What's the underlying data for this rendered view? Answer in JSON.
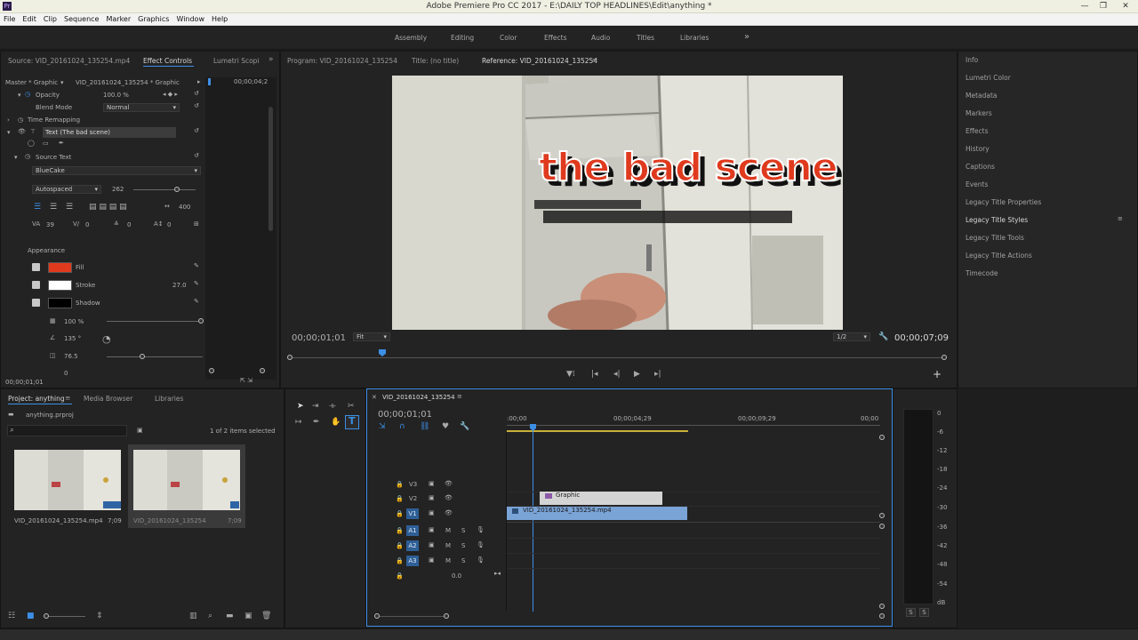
{
  "window": {
    "title": "Adobe Premiere Pro CC 2017 - E:\\DAILY TOP HEADLINES\\Edit\\anything *",
    "menu": [
      "File",
      "Edit",
      "Clip",
      "Sequence",
      "Marker",
      "Graphics",
      "Window",
      "Help"
    ]
  },
  "workspaces": [
    "Assembly",
    "Editing",
    "Color",
    "Effects",
    "Audio",
    "Titles",
    "Libraries"
  ],
  "effect_panel": {
    "tabs": [
      "Source: VID_20161024_135254.mp4",
      "Effect Controls",
      "Lumetri Scopi"
    ],
    "master_label": "Master * Graphic",
    "clip_label": "VID_20161024_135254 * Graphic",
    "timecode_right": "00;00;04;2",
    "opacity_label": "Opacity",
    "opacity_value": "100.0 %",
    "blend_label": "Blend Mode",
    "blend_value": "Normal",
    "time_remapping": "Time Remapping",
    "text_layer": "Text (The bad scene)",
    "source_text": "Source Text",
    "font": "BlueCake",
    "spacing_mode": "Autospaced",
    "size_value": "262",
    "tracking_value": "400",
    "kern_value": "39",
    "tsume_value": "0",
    "leading_value": "0",
    "baseline_value": "0",
    "appearance": "Appearance",
    "fill_label": "Fill",
    "stroke_label": "Stroke",
    "stroke_value": "27.0",
    "shadow_label": "Shadow",
    "shadow_opacity": "100 %",
    "shadow_angle": "135 °",
    "shadow_distance": "76.5",
    "shadow_size_value": "0",
    "bottom_timecode": "00;00;01;01",
    "fill_color": "#e03a1e",
    "stroke_color": "#ffffff",
    "shadow_color": "#000000"
  },
  "program_monitor": {
    "tabs": [
      "Program: VID_20161024_135254",
      "Title: (no title)",
      "Reference: VID_20161024_135254"
    ],
    "overlay_text": "the bad scene",
    "current_time": "00;00;01;01",
    "fit": "Fit",
    "resolution": "1/2",
    "duration": "00;00;07;09"
  },
  "right_panel": {
    "items": [
      "Info",
      "Lumetri Color",
      "Metadata",
      "Markers",
      "Effects",
      "History",
      "Captions",
      "Events",
      "Legacy Title Properties",
      "Legacy Title Styles",
      "Legacy Title Tools",
      "Legacy Title Actions",
      "Timecode"
    ]
  },
  "project_panel": {
    "tabs": [
      "Project: anything",
      "Media Browser",
      "Libraries"
    ],
    "project_file": "anything.prproj",
    "items_count": "1 of 2 items selected",
    "items": [
      {
        "name": "VID_20161024_135254.mp4",
        "duration": "7;09"
      },
      {
        "name": "VID_20161024_135254",
        "duration": "7;09"
      }
    ]
  },
  "timeline": {
    "tab": "VID_20161024_135254",
    "current_time": "00;00;01;01",
    "ruler": [
      ":00;00",
      "00;00;04;29",
      "00;00;09;29",
      "00;00"
    ],
    "tracks": [
      {
        "tag": "V3"
      },
      {
        "tag": "V2"
      },
      {
        "tag": "V1"
      },
      {
        "tag": "A1"
      },
      {
        "tag": "A2"
      },
      {
        "tag": "A3"
      }
    ],
    "m_label": "M",
    "s_label": "S",
    "master_value": "0.0",
    "clip_graphic": "Graphic",
    "clip_video": "VID_20161024_135254.mp4"
  },
  "audio_meter": {
    "scale": [
      "0",
      "-6",
      "-12",
      "-18",
      "-24",
      "-30",
      "-36",
      "-42",
      "-48",
      "-54",
      "dB"
    ],
    "solo_labels": [
      "S",
      "S"
    ]
  }
}
